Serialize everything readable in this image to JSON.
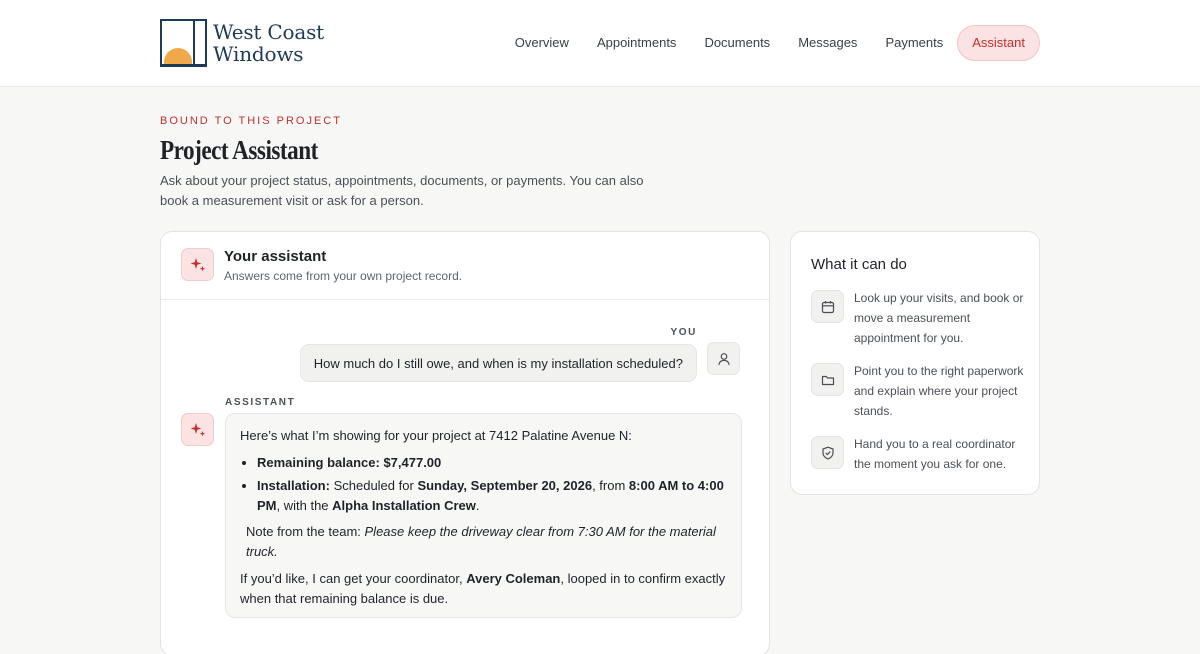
{
  "brand": {
    "line1": "West Coast",
    "line2": "Windows"
  },
  "nav": {
    "items": [
      {
        "label": "Overview"
      },
      {
        "label": "Appointments"
      },
      {
        "label": "Documents"
      },
      {
        "label": "Messages"
      },
      {
        "label": "Payments"
      },
      {
        "label": "Assistant",
        "active": true
      }
    ]
  },
  "page": {
    "eyebrow": "BOUND TO THIS PROJECT",
    "title": "Project Assistant",
    "lede": "Ask about your project status, appointments, documents, or payments. You can also book a measurement visit or ask for a person."
  },
  "chat": {
    "title": "Your assistant",
    "subtitle": "Answers come from your own project record.",
    "you_label": "YOU",
    "user_message": "How much do I still owe, and when is my installation scheduled?",
    "assistant_label": "ASSISTANT",
    "reply": {
      "intro": "Here’s what I’m showing for your project at 7412 Palatine Avenue N:",
      "balance_label": "Remaining balance:",
      "balance_value": "$7,477.00",
      "install_label": "Installation:",
      "install_pre": "Scheduled for",
      "install_date": "Sunday, September 20, 2026",
      "install_mid": ", from",
      "install_time": "8:00 AM to 4:00 PM",
      "install_post": ", with the",
      "install_crew": "Alpha Installation Crew",
      "install_end": ".",
      "note_label": "Note from the team:",
      "note_text": "Please keep the driveway clear from 7:30 AM for the material truck.",
      "follow_pre": "If you’d like, I can get your coordinator,",
      "coordinator": "Avery Coleman",
      "follow_post": ", looped in to confirm exactly when that remaining balance is due."
    }
  },
  "capabilities": {
    "title": "What it can do",
    "items": [
      {
        "icon": "calendar-icon",
        "text": "Look up your visits, and book or move a measurement appointment for you."
      },
      {
        "icon": "folder-icon",
        "text": "Point you to the right paperwork and explain where your project stands."
      },
      {
        "icon": "shield-check-icon",
        "text": "Hand you to a real coordinator the moment you ask for one."
      }
    ]
  },
  "colors": {
    "accent": "#c2302d",
    "accent_soft": "#fbe3e3",
    "brand_navy": "#1d3a5a",
    "sun": "#efa94a"
  }
}
